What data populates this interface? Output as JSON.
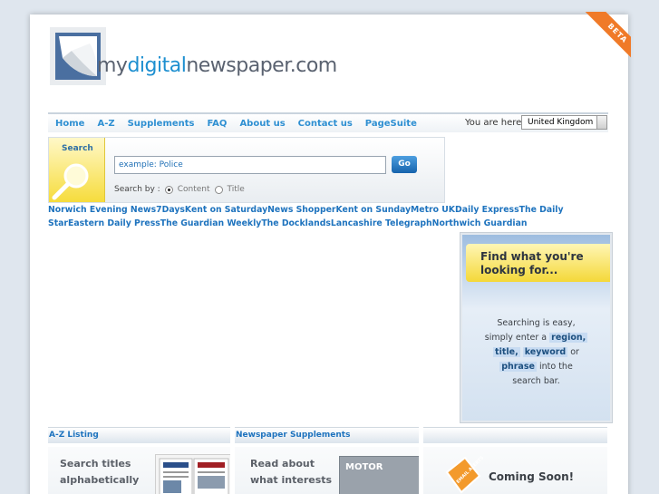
{
  "logo": {
    "my": "my",
    "digital": "digital",
    "newspaper": "newspaper.com"
  },
  "beta": "BETA",
  "nav": {
    "items": [
      "Home",
      "A-Z",
      "Supplements",
      "FAQ",
      "About us",
      "Contact us",
      "PageSuite"
    ],
    "region_label": "You are here..",
    "region_value": "United Kingdom"
  },
  "search": {
    "side_label": "Search",
    "placeholder": "example: Police",
    "go_label": "Go",
    "search_by_label": "Search by :",
    "options": [
      "Content",
      "Title"
    ],
    "selected": "Content"
  },
  "links": [
    "Norwich Evening News",
    "7Days",
    "Kent on Saturday",
    "News Shopper",
    "Kent on Sunday",
    "Metro UK",
    "Daily Express",
    "The Daily Star",
    "Eastern Daily Press",
    "The Guardian Weekly",
    "The Docklands",
    "Lancashire Telegraph",
    "Northwich Guardian"
  ],
  "promo": {
    "title_line1": "Find what you're",
    "title_line2": "looking for...",
    "body": {
      "l1": "Searching is easy,",
      "l2_pre": "simply enter a",
      "region": "region,",
      "title": "title,",
      "keyword": "keyword",
      "or": "or",
      "phrase": "phrase",
      "l4_post": "into the",
      "l5": "search bar."
    }
  },
  "columns": {
    "col1": {
      "heading": "A-Z Listing",
      "line1": "Search titles",
      "line2": "alphabetically"
    },
    "col2": {
      "heading": "Newspaper Supplements",
      "line1": "Read about",
      "line2": "what interests",
      "thumb_label": "MOTOR"
    },
    "col3": {
      "heading": "",
      "coming_soon": "Coming Soon!",
      "icon_text": "EMAIL ALERTS"
    }
  },
  "colors": {
    "accent": "#1e73be",
    "beta": "#f07a28",
    "search_yellow": "#f6dc3c"
  }
}
